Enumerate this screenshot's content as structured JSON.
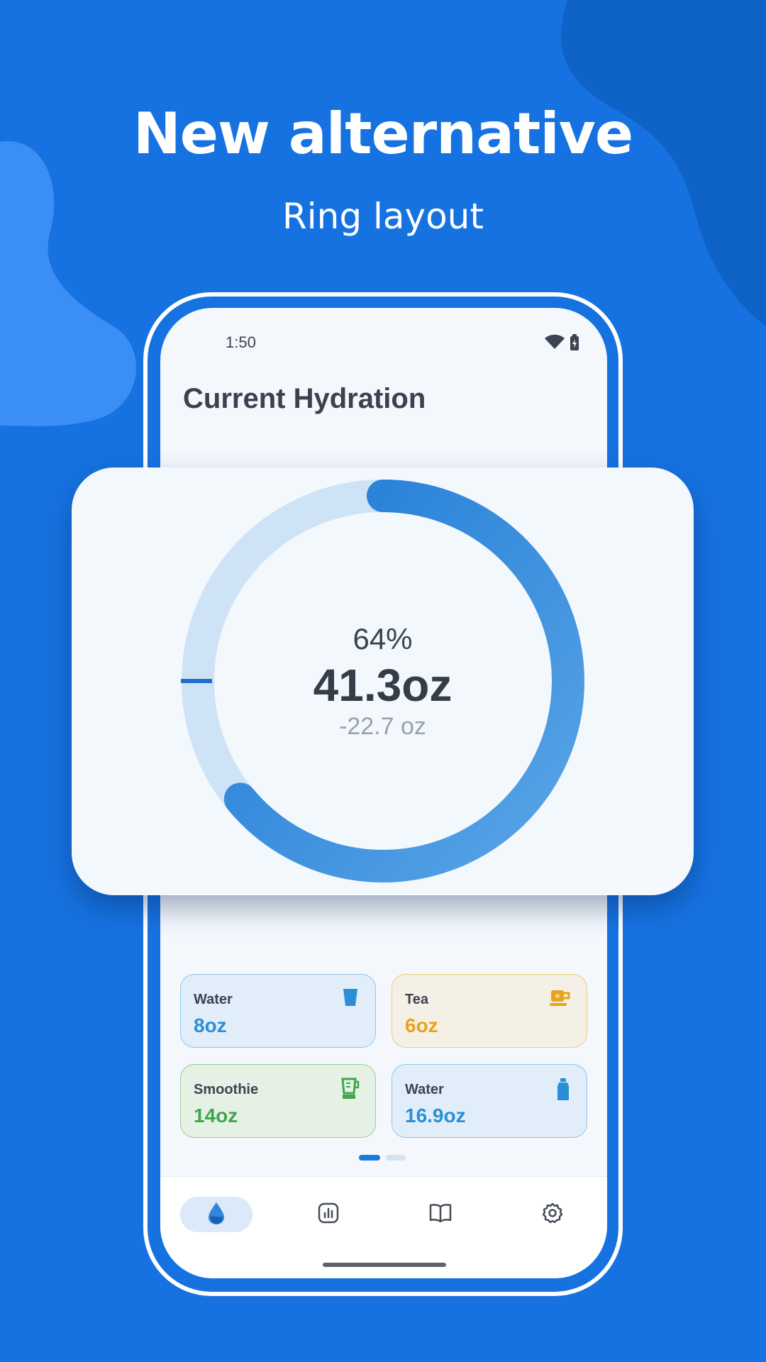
{
  "promo": {
    "headline": "New alternative",
    "subline": "Ring layout"
  },
  "status_bar": {
    "time": "1:50",
    "icons": [
      "wifi-icon",
      "battery-icon"
    ]
  },
  "screen": {
    "title": "Current Hydration"
  },
  "ring": {
    "percent_label": "64%",
    "total_label": "41.3oz",
    "remaining_label": "-22.7 oz",
    "progress_fraction": 0.64,
    "track_color": "#cfe3f6",
    "progress_color": "#2f86dc"
  },
  "drinks": [
    {
      "name": "Water",
      "amount": "8oz",
      "icon": "cup-icon",
      "color": "#2a8fd6",
      "bg": "#e1eef9",
      "border": "#8ec4ea"
    },
    {
      "name": "Tea",
      "amount": "6oz",
      "icon": "teapot-icon",
      "color": "#e8a21c",
      "bg": "#f5f0e5",
      "border": "#f1cb7a"
    },
    {
      "name": "Smoothie",
      "amount": "14oz",
      "icon": "blender-icon",
      "color": "#3fa64a",
      "bg": "#e6f1e6",
      "border": "#94cd95"
    },
    {
      "name": "Water",
      "amount": "16.9oz",
      "icon": "bottle-icon",
      "color": "#2a8fd6",
      "bg": "#e1eef9",
      "border": "#8ec4ea"
    }
  ],
  "pager": {
    "pages": 2,
    "current": 1
  },
  "nav": [
    {
      "icon": "water-drop-icon",
      "active": true
    },
    {
      "icon": "stats-icon",
      "active": false
    },
    {
      "icon": "book-icon",
      "active": false
    },
    {
      "icon": "settings-gear-icon",
      "active": false
    }
  ],
  "colors": {
    "background": "#1672e0",
    "accent": "#2f86dc"
  }
}
